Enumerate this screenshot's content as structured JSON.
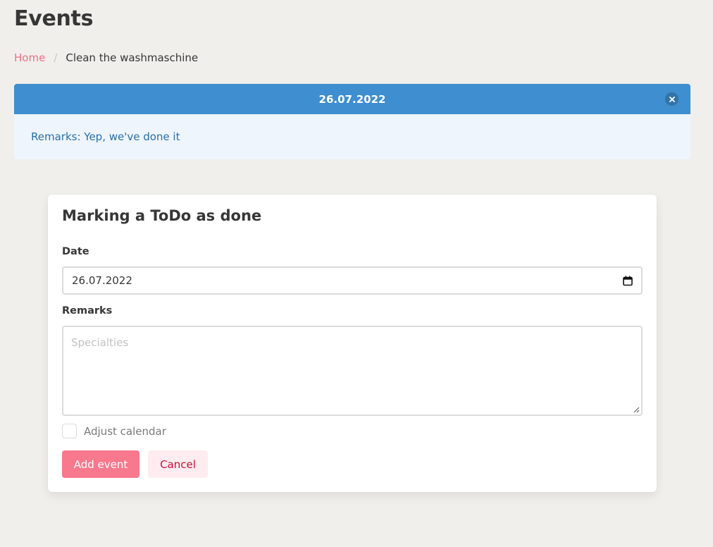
{
  "page": {
    "title": "Events"
  },
  "breadcrumb": {
    "home": "Home",
    "separator": "/",
    "current": "Clean the washmaschine"
  },
  "message": {
    "header": "26.07.2022",
    "body": "Remarks: Yep, we've done it",
    "close_icon": "close-icon",
    "header_color": "#3e8ed0",
    "body_bg": "#eef5fc",
    "body_text_color": "#296fa8"
  },
  "form": {
    "title": "Marking a ToDo as done",
    "date_label": "Date",
    "date_value": "26.07.2022",
    "calendar_icon": "calendar-icon",
    "remarks_label": "Remarks",
    "remarks_placeholder": "Specialties",
    "checkbox_label": "Adjust calendar",
    "checkbox_checked": false,
    "submit_label": "Add event",
    "cancel_label": "Cancel"
  },
  "colors": {
    "background": "#f0efeb",
    "primary": "#f8788d",
    "link": "#f36f83",
    "danger_light_bg": "#feecf0",
    "danger_light_text": "#cc0f35"
  }
}
